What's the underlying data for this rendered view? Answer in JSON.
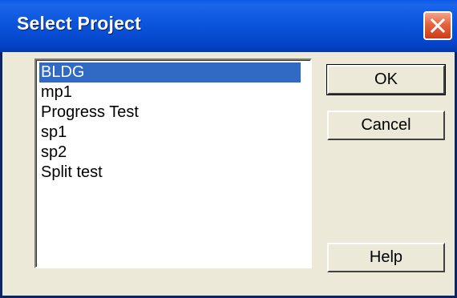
{
  "dialog": {
    "title": "Select Project",
    "colors": {
      "titlebar": "#0b55dd",
      "selection": "#316ac5",
      "face": "#ece9d8",
      "close": "#e5643d"
    }
  },
  "projects": [
    {
      "label": "BLDG",
      "selected": true
    },
    {
      "label": "mp1",
      "selected": false
    },
    {
      "label": "Progress Test",
      "selected": false
    },
    {
      "label": "sp1",
      "selected": false
    },
    {
      "label": "sp2",
      "selected": false
    },
    {
      "label": "Split test",
      "selected": false
    }
  ],
  "buttons": {
    "ok": "OK",
    "cancel": "Cancel",
    "help": "Help"
  }
}
